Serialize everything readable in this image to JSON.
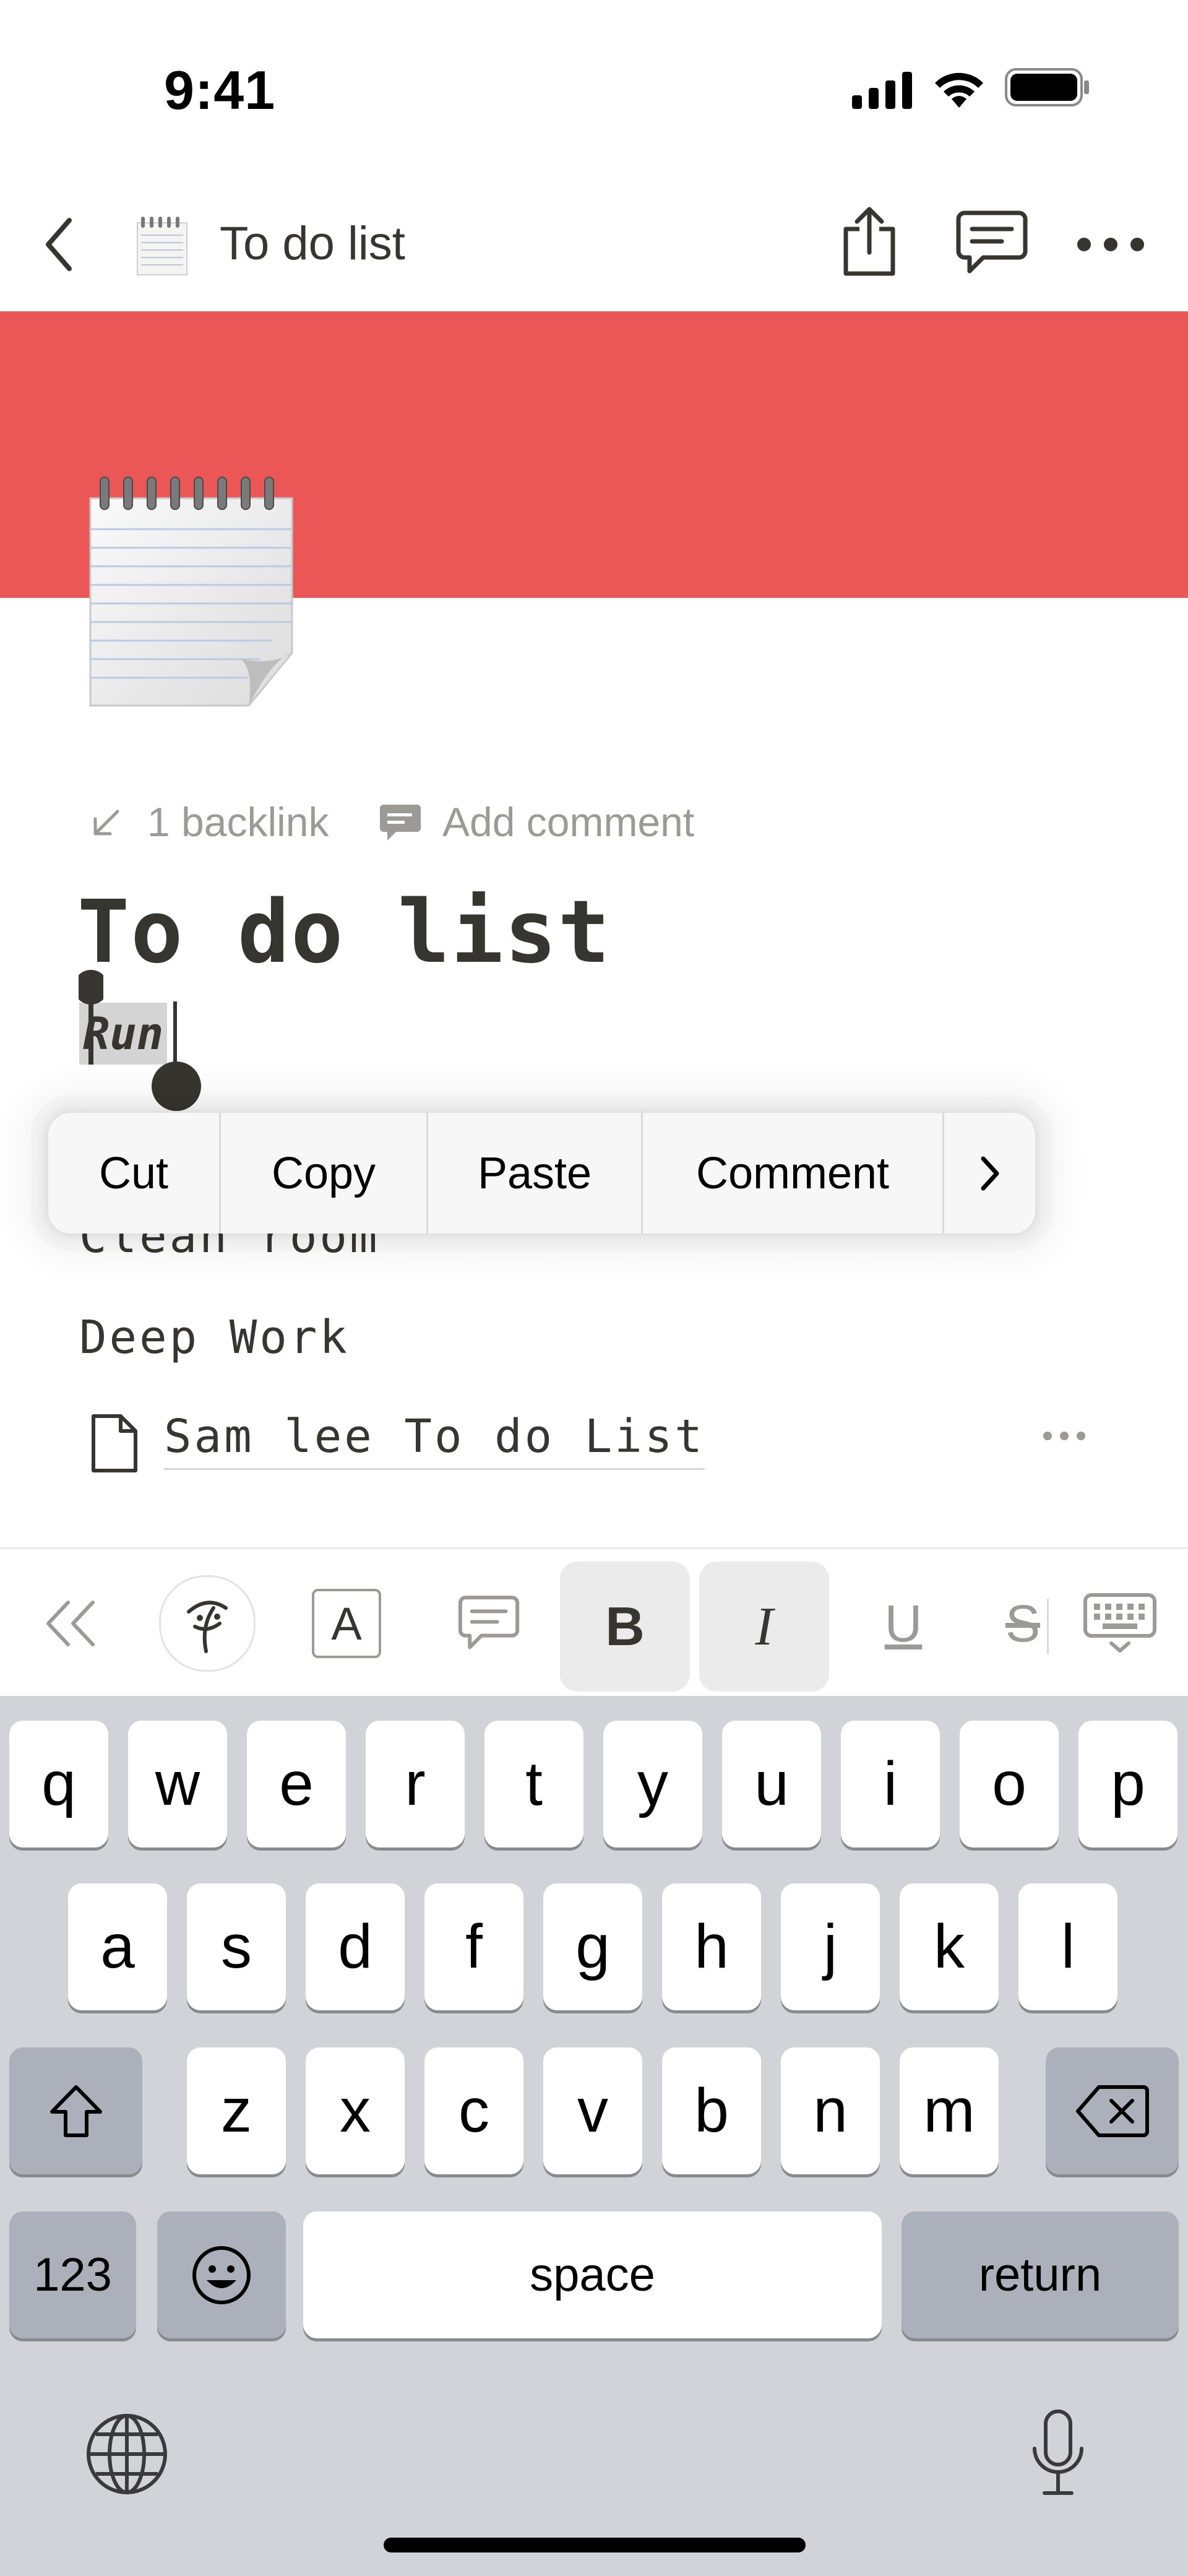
{
  "status_bar": {
    "time": "9:41"
  },
  "nav": {
    "title": "To do list",
    "back_icon": "chevron-left-icon",
    "page_icon": "notepad-icon"
  },
  "cover": {
    "color": "#eb5757",
    "page_emoji": "spiral-notepad"
  },
  "meta": {
    "backlinks": "1 backlink",
    "add_comment": "Add comment"
  },
  "page": {
    "title": "To do list",
    "selected_line": "Run",
    "lines": [
      "Clean room",
      "Deep Work"
    ],
    "subpage": "Sam lee To do List"
  },
  "context_menu": {
    "items": [
      "Cut",
      "Copy",
      "Paste",
      "Comment"
    ]
  },
  "toolbar": {
    "bold": "B",
    "italic": "I",
    "underline": "U",
    "strike": "S",
    "text_color": "A"
  },
  "keyboard": {
    "row1": [
      "q",
      "w",
      "e",
      "r",
      "t",
      "y",
      "u",
      "i",
      "o",
      "p"
    ],
    "row2": [
      "a",
      "s",
      "d",
      "f",
      "g",
      "h",
      "j",
      "k",
      "l"
    ],
    "row3": [
      "z",
      "x",
      "c",
      "v",
      "b",
      "n",
      "m"
    ],
    "numbers": "123",
    "space": "space",
    "return": "return"
  }
}
